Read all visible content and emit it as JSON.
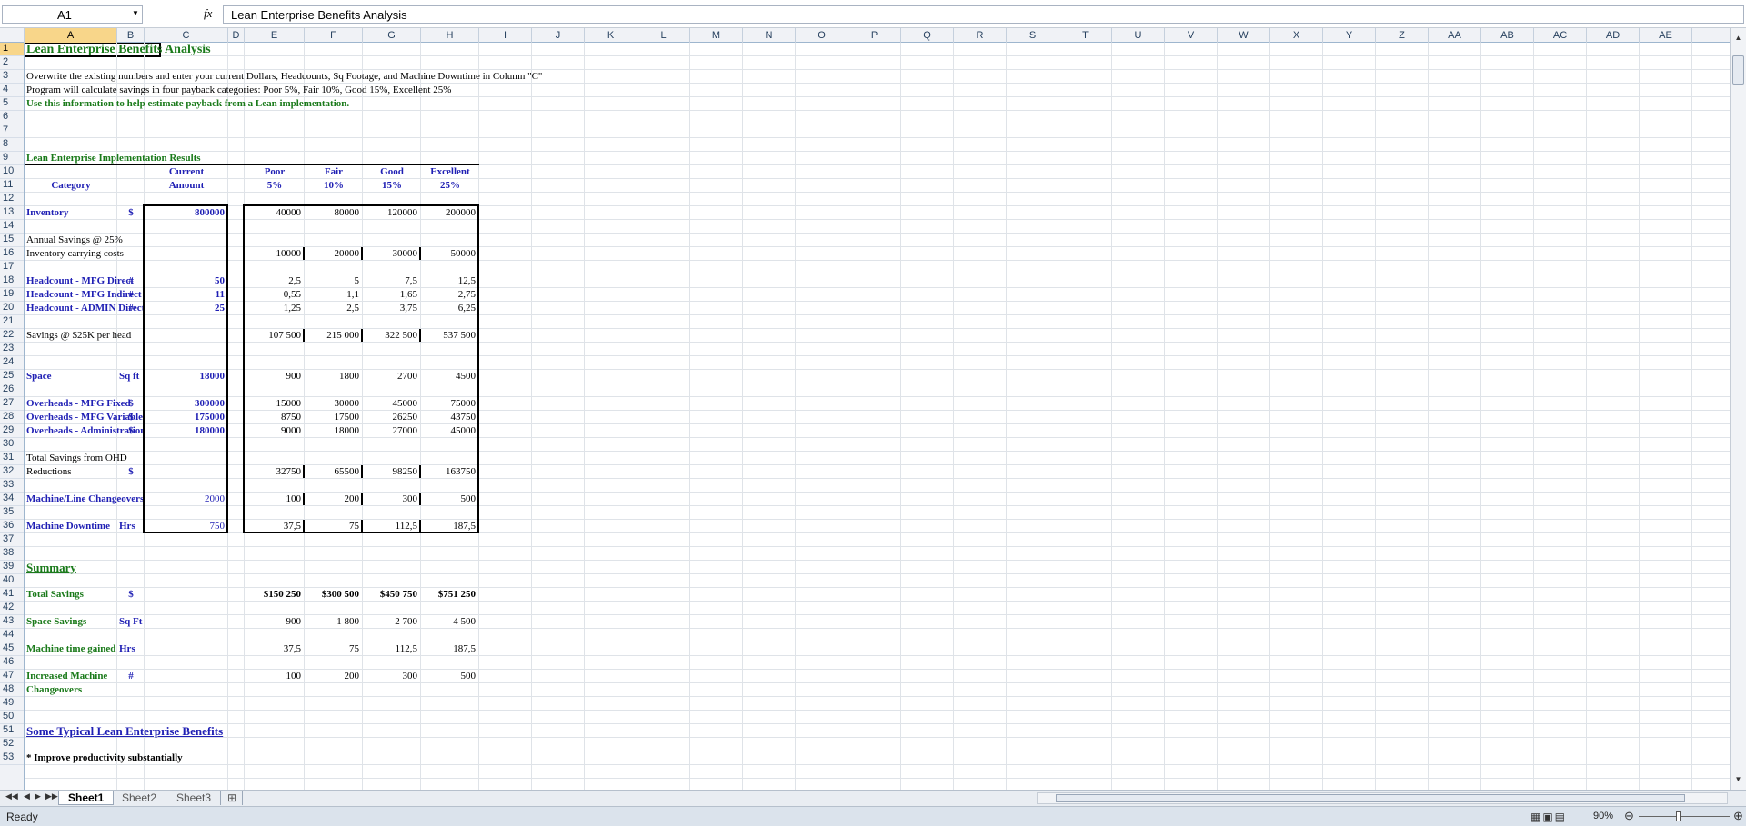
{
  "formula_bar": {
    "name_box": "A1",
    "formula": "Lean Enterprise Benefits Analysis",
    "fx": "fx"
  },
  "columns": [
    [
      "A",
      102
    ],
    [
      "B",
      30
    ],
    [
      "C",
      92
    ],
    [
      "D",
      18
    ],
    [
      "E",
      66
    ],
    [
      "F",
      64
    ],
    [
      "G",
      64
    ],
    [
      "H",
      64
    ],
    [
      "I",
      58
    ],
    [
      "J",
      58
    ],
    [
      "K",
      58
    ],
    [
      "L",
      58
    ],
    [
      "M",
      58
    ],
    [
      "N",
      58
    ],
    [
      "O",
      58
    ],
    [
      "P",
      58
    ],
    [
      "Q",
      58
    ],
    [
      "R",
      58
    ],
    [
      "S",
      58
    ],
    [
      "T",
      58
    ],
    [
      "U",
      58
    ],
    [
      "V",
      58
    ],
    [
      "W",
      58
    ],
    [
      "X",
      58
    ],
    [
      "Y",
      58
    ],
    [
      "Z",
      58
    ],
    [
      "AA",
      58
    ],
    [
      "AB",
      58
    ],
    [
      "AC",
      58
    ],
    [
      "AD",
      58
    ],
    [
      "AE",
      58
    ]
  ],
  "rows": [
    "1",
    "2",
    "3",
    "4",
    "5",
    "6",
    "7",
    "8",
    "9",
    "10",
    "11",
    "12",
    "13",
    "14",
    "15",
    "16",
    "17",
    "18",
    "19",
    "20",
    "21",
    "22",
    "23",
    "24",
    "25",
    "26",
    "27",
    "28",
    "29",
    "30",
    "31",
    "32",
    "33",
    "34",
    "35",
    "36",
    "37",
    "38",
    "39",
    "40",
    "41",
    "42",
    "43",
    "44",
    "45",
    "46",
    "47",
    "48",
    "49",
    "50",
    "51",
    "52",
    "53"
  ],
  "sheet": {
    "title": "Lean Enterprise Benefits Analysis",
    "intro1": "Overwrite the existing numbers and enter your current Dollars, Headcounts, Sq Footage, and Machine Downtime in Column \"C\"",
    "intro2": "Program will calculate savings in four payback categories: Poor 5%, Fair 10%, Good 15%, Excellent 25%",
    "intro3": "Use this information to help estimate payback from a Lean implementation.",
    "results_title": "Lean Enterprise Implementation Results",
    "hdr_current": "Current",
    "hdr_amount": "Amount",
    "hdr_category": "Category",
    "hdr_poor": "Poor",
    "hdr_poor_pct": "5%",
    "hdr_fair": "Fair",
    "hdr_fair_pct": "10%",
    "hdr_good": "Good",
    "hdr_good_pct": "15%",
    "hdr_exc": "Excellent",
    "hdr_exc_pct": "25%",
    "inventory": "Inventory",
    "inventory_unit": "$",
    "inventory_cur": "800000",
    "inventory_vals": [
      "40000",
      "80000",
      "120000",
      "200000"
    ],
    "annual_savings": "Annual Savings @ 25%",
    "carrying": "Inventory carrying costs",
    "carrying_vals": [
      "10000",
      "20000",
      "30000",
      "50000"
    ],
    "hc_direct": "Headcount - MFG Direct",
    "hc_direct_unit": "#",
    "hc_direct_cur": "50",
    "hc_direct_vals": [
      "2,5",
      "5",
      "7,5",
      "12,5"
    ],
    "hc_indirect": "Headcount - MFG Indirect",
    "hc_indirect_unit": "#",
    "hc_indirect_cur": "11",
    "hc_indirect_vals": [
      "0,55",
      "1,1",
      "1,65",
      "2,75"
    ],
    "hc_admin": "Headcount - ADMIN Direct",
    "hc_admin_unit": "#",
    "hc_admin_cur": "25",
    "hc_admin_vals": [
      "1,25",
      "2,5",
      "3,75",
      "6,25"
    ],
    "savings_head": "Savings @ $25K per head",
    "savings_head_vals": [
      "107 500",
      "215 000",
      "322 500",
      "537 500"
    ],
    "space": "Space",
    "space_unit": "Sq ft",
    "space_cur": "18000",
    "space_vals": [
      "900",
      "1800",
      "2700",
      "4500"
    ],
    "ohd_fixed": "Overheads - MFG Fixed",
    "ohd_fixed_unit": "$",
    "ohd_fixed_cur": "300000",
    "ohd_fixed_vals": [
      "15000",
      "30000",
      "45000",
      "75000"
    ],
    "ohd_var": "Overheads - MFG Variable",
    "ohd_var_unit": "$",
    "ohd_var_cur": "175000",
    "ohd_var_vals": [
      "8750",
      "17500",
      "26250",
      "43750"
    ],
    "ohd_admin": "Overheads - Administration",
    "ohd_admin_unit": "$",
    "ohd_admin_cur": "180000",
    "ohd_admin_vals": [
      "9000",
      "18000",
      "27000",
      "45000"
    ],
    "ohd_total1": "Total Savings from OHD",
    "ohd_total2": "Reductions",
    "ohd_total_unit": "$",
    "ohd_total_vals": [
      "32750",
      "65500",
      "98250",
      "163750"
    ],
    "changeovers": "Machine/Line Changeovers",
    "changeovers_cur": "2000",
    "changeovers_vals": [
      "100",
      "200",
      "300",
      "500"
    ],
    "downtime": "Machine Downtime",
    "downtime_unit": "Hrs",
    "downtime_cur": "750",
    "downtime_vals": [
      "37,5",
      "75",
      "112,5",
      "187,5"
    ],
    "summary": "Summary",
    "total_savings": "Total Savings",
    "total_savings_unit": "$",
    "total_savings_vals": [
      "$150 250",
      "$300 500",
      "$450 750",
      "$751 250"
    ],
    "space_savings": "Space Savings",
    "space_savings_unit": "Sq Ft",
    "space_savings_vals": [
      "900",
      "1 800",
      "2 700",
      "4 500"
    ],
    "machine_time": "Machine time gained",
    "machine_time_unit": "Hrs",
    "machine_time_vals": [
      "37,5",
      "75",
      "112,5",
      "187,5"
    ],
    "inc_changeovers1": "Increased Machine",
    "inc_changeovers2": "Changeovers",
    "inc_changeovers_unit": "#",
    "inc_changeovers_vals": [
      "100",
      "200",
      "300",
      "500"
    ],
    "typical": "Some Typical Lean Enterprise Benefits",
    "typical_1": "* Improve productivity substantially"
  },
  "tabs": [
    "Sheet1",
    "Sheet2",
    "Sheet3"
  ],
  "status": {
    "text": "Ready",
    "zoom": "90%"
  }
}
